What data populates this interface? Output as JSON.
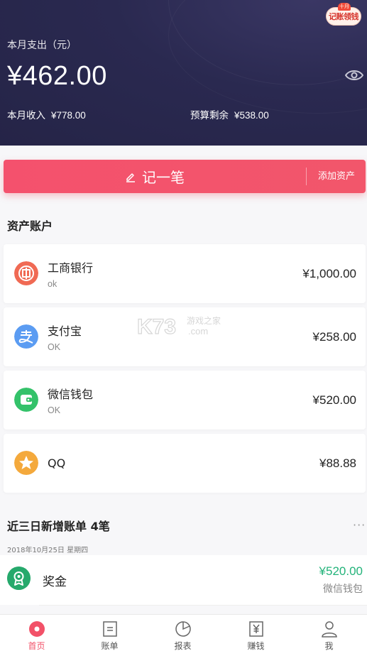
{
  "header": {
    "badge_top": "十月",
    "badge_text": "记账领钱",
    "expense_label": "本月支出（元）",
    "expense_amount": "¥462.00",
    "income_label": "本月收入",
    "income_value": "¥778.00",
    "budget_label": "预算剩余",
    "budget_value": "¥538.00"
  },
  "record_bar": {
    "main_label": "记一笔",
    "add_asset_label": "添加资产"
  },
  "assets": {
    "title": "资产账户",
    "items": [
      {
        "name": "工商银行",
        "sub": "ok",
        "amount": "¥1,000.00",
        "icon": "icbc-icon",
        "color": "#f06a54"
      },
      {
        "name": "支付宝",
        "sub": "OK",
        "amount": "¥258.00",
        "icon": "alipay-icon",
        "color": "#5b9cf2"
      },
      {
        "name": "微信钱包",
        "sub": "OK",
        "amount": "¥520.00",
        "icon": "wallet-icon",
        "color": "#34c26a"
      },
      {
        "name": "QQ",
        "sub": "",
        "amount": "¥88.88",
        "icon": "star-icon",
        "color": "#f4a93c"
      }
    ]
  },
  "recent": {
    "title": "近三日新增账单 4笔",
    "more": "···",
    "date": "2018年10月25日 星期四",
    "bill": {
      "name": "奖金",
      "amount": "¥520.00",
      "source": "微信钱包",
      "icon": "medal-icon"
    }
  },
  "watermark": {
    "main": "K73",
    "sub1": "游戏之家",
    "sub2": ".com"
  },
  "nav": {
    "items": [
      {
        "label": "首页",
        "icon": "home-icon",
        "active": true
      },
      {
        "label": "账单",
        "icon": "bill-icon",
        "active": false
      },
      {
        "label": "报表",
        "icon": "chart-icon",
        "active": false
      },
      {
        "label": "赚钱",
        "icon": "yen-icon",
        "active": false
      },
      {
        "label": "我",
        "icon": "user-icon",
        "active": false
      }
    ]
  },
  "colors": {
    "accent": "#f25168",
    "header_bg": "#2a2950",
    "income_green": "#23b37a"
  }
}
